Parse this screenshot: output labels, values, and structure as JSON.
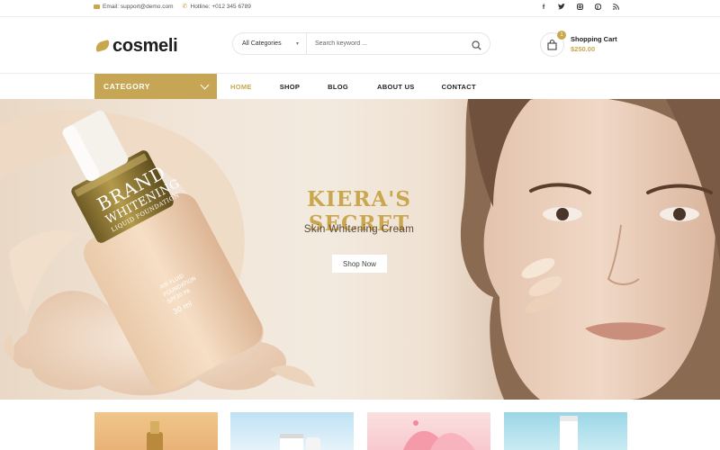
{
  "topbar": {
    "email": "Email: support@demo.com",
    "hotline": "Hotline: +012 345 6789",
    "social_icons": [
      "facebook-icon",
      "twitter-icon",
      "instagram-icon",
      "pinterest-icon",
      "rss-icon"
    ]
  },
  "header": {
    "logo_text": "cosmeli",
    "search": {
      "category_selected": "All Categories",
      "placeholder": "Search keyword ..."
    },
    "cart": {
      "count": "1",
      "label": "Shopping Cart",
      "total": "$250.00"
    }
  },
  "nav": {
    "category_label": "CATEGORY",
    "items": [
      {
        "label": "HOME",
        "active": true
      },
      {
        "label": "SHOP",
        "active": false
      },
      {
        "label": "BLOG",
        "active": false
      },
      {
        "label": "ABOUT US",
        "active": false
      },
      {
        "label": "CONTACT",
        "active": false
      }
    ]
  },
  "hero": {
    "title": "KIERA'S SECRET",
    "subtitle": "Skin Whitening Cream",
    "button": "Shop Now",
    "product_label": {
      "brand": "BRAND",
      "line1": "WHITENING",
      "line2": "LIQUID FOUNDATION",
      "line3": "AIR FLUID",
      "line4": "FOUNDATION",
      "line5": "SPF30 PA",
      "volume": "30 ml"
    }
  },
  "colors": {
    "accent": "#c9a74f",
    "category_bg": "#c6a654",
    "text_dark": "#222222"
  }
}
